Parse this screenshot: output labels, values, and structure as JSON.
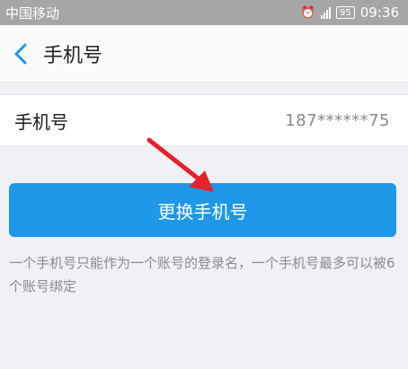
{
  "status_bar": {
    "carrier": "中国移动",
    "battery": "95",
    "time": "09:36"
  },
  "header": {
    "title": "手机号"
  },
  "phone_row": {
    "label": "手机号",
    "value": "187******75"
  },
  "change_button": {
    "label": "更换手机号"
  },
  "hint": {
    "text": "一个手机号只能作为一个账号的登录名，一个手机号最多可以被6个账号绑定"
  },
  "colors": {
    "accent": "#1e97e8",
    "annotation_arrow": "#e5212b"
  }
}
